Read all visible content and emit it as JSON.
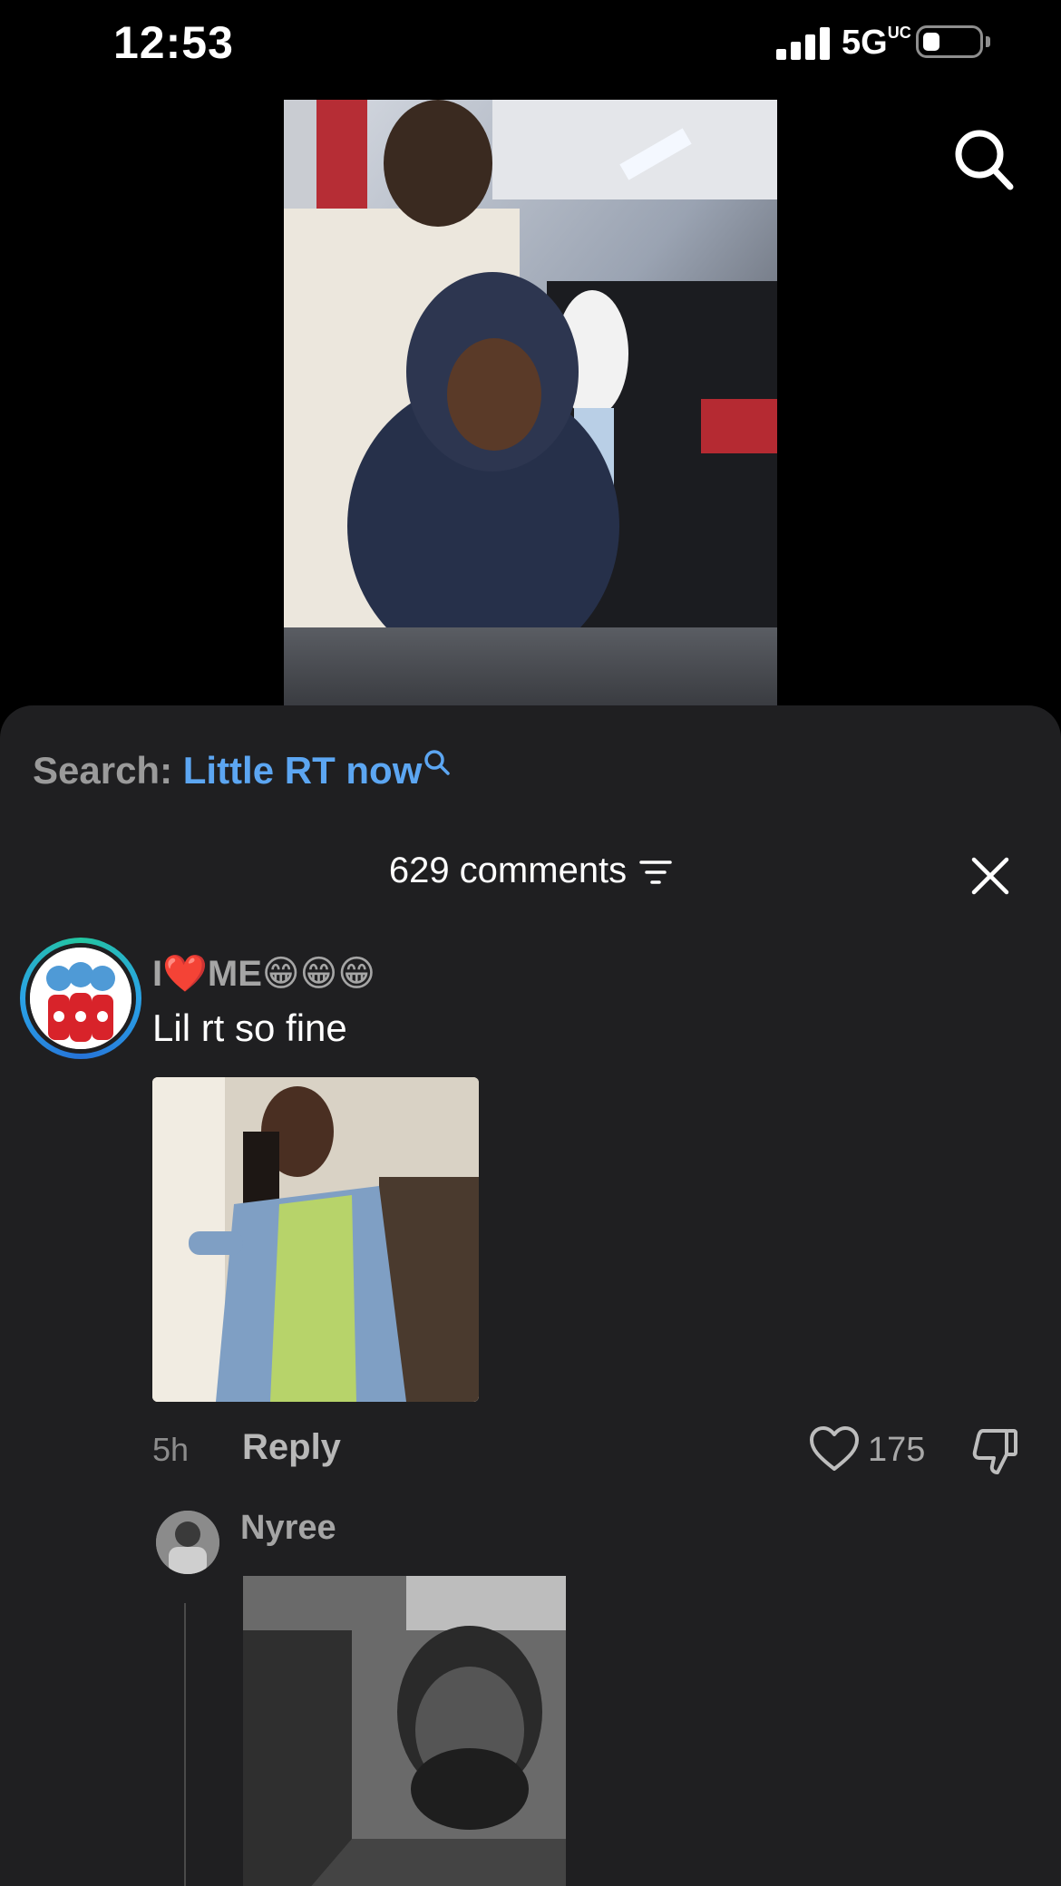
{
  "status_bar": {
    "time": "12:53",
    "network": "5G",
    "network_suffix": "UC",
    "battery_icon": "battery-low-icon"
  },
  "video": {
    "search_icon": "search-icon"
  },
  "comments_sheet": {
    "search_label": "Search:",
    "search_query": "Little RT now",
    "comment_count_label": "629 comments",
    "filter_icon": "filter-icon",
    "close_icon": "close-icon"
  },
  "comment": {
    "username": "I❤️ME😁😁😁",
    "text": "Lil rt so fine",
    "time": "5h",
    "reply_label": "Reply",
    "like_count": "175"
  },
  "reply": {
    "username": "Nyree"
  },
  "colors": {
    "sheet_bg": "#1f1f21",
    "accent_link": "#5ca6f2",
    "avatar_ring": "#2aa2e6"
  }
}
